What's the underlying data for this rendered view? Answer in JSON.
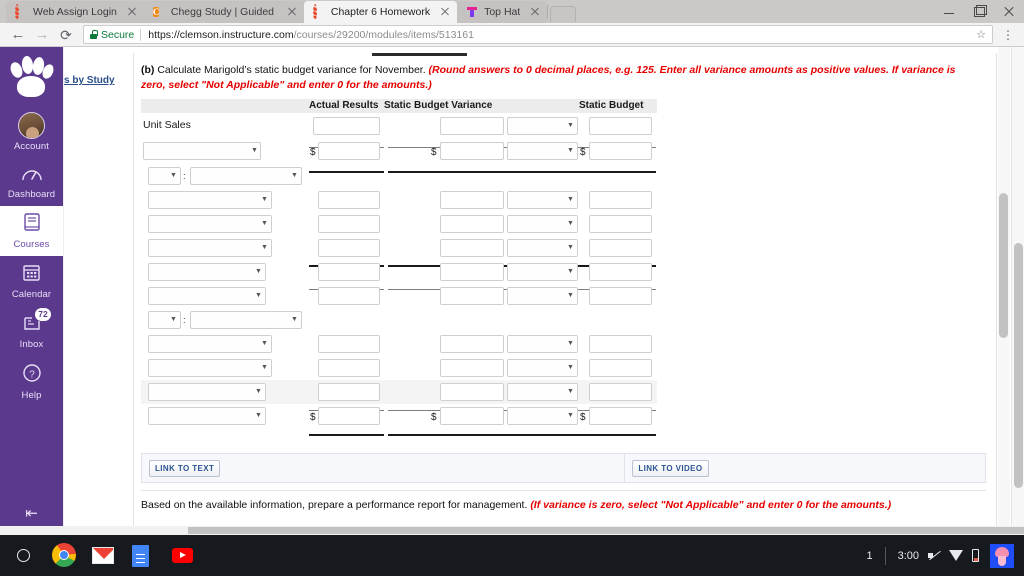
{
  "browser": {
    "tabs": [
      {
        "title": "Web Assign Login",
        "favicon": "spinner-icon",
        "active": false
      },
      {
        "title": "Chegg Study | Guided So",
        "favicon": "chegg-c-icon",
        "active": false
      },
      {
        "title": "Chapter 6 Homework",
        "favicon": "spinner-icon",
        "active": true
      },
      {
        "title": "Top Hat",
        "favicon": "tophat-t-icon",
        "active": false
      }
    ],
    "window_controls": {
      "minimize": "minimize-icon",
      "maximize": "restore-icon",
      "close": "close-icon"
    },
    "toolbar": {
      "back": "back-arrow-icon",
      "forward": "forward-arrow-icon",
      "reload": "reload-icon",
      "security_label": "Secure",
      "url_host": "https://clemson.instructure.com",
      "url_path": "/courses/29200/modules/items/513161",
      "bookmark": "star-icon",
      "menu": "kebab-menu-icon"
    }
  },
  "canvas_nav": {
    "logo": "clemson-paw-logo",
    "items": [
      {
        "label": "Account",
        "icon": "user-avatar-icon",
        "active": false,
        "badge": ""
      },
      {
        "label": "Dashboard",
        "icon": "dashboard-gauge-icon",
        "active": false,
        "badge": ""
      },
      {
        "label": "Courses",
        "icon": "book-icon",
        "active": true,
        "badge": ""
      },
      {
        "label": "Calendar",
        "icon": "calendar-icon",
        "active": false,
        "badge": ""
      },
      {
        "label": "Inbox",
        "icon": "inbox-icon",
        "active": false,
        "badge": "72"
      },
      {
        "label": "Help",
        "icon": "question-circle-icon",
        "active": false,
        "badge": ""
      }
    ],
    "collapse_label": "⇤"
  },
  "page": {
    "breadcrumb_link": "s by Study"
  },
  "assignment": {
    "prompt_prefix": "(b)",
    "prompt_text": " Calculate Marigold’s static budget variance for November. ",
    "prompt_note": "(Round answers to 0 decimal places, e.g. 125. Enter all variance amounts as positive values. If variance is zero, select \"Not Applicable\" and enter 0 for the amounts.)",
    "columns": {
      "blank": "",
      "actual_results": "Actual Results",
      "static_budget_variance": "Static Budget Variance",
      "static_budget": "Static Budget"
    },
    "rows": [
      {
        "label": "Unit Sales",
        "type": "label",
        "dollar": false,
        "shaded": false
      },
      {
        "label": "",
        "type": "select-wide",
        "dollar": true,
        "shaded": false
      },
      {
        "label": "",
        "type": "select-pair",
        "dollar": false,
        "shaded": false
      },
      {
        "label": "",
        "type": "select-mid",
        "dollar": false,
        "shaded": false
      },
      {
        "label": "",
        "type": "select-mid",
        "dollar": false,
        "shaded": false
      },
      {
        "label": "",
        "type": "select-mid",
        "dollar": false,
        "shaded": false
      },
      {
        "label": "",
        "type": "select-wide",
        "dollar": false,
        "shaded": false
      },
      {
        "label": "",
        "type": "select-wide",
        "dollar": false,
        "shaded": false
      },
      {
        "label": "",
        "type": "select-pair",
        "dollar": false,
        "shaded": false
      },
      {
        "label": "",
        "type": "select-mid",
        "dollar": false,
        "shaded": false
      },
      {
        "label": "",
        "type": "select-mid",
        "dollar": false,
        "shaded": false
      },
      {
        "label": "",
        "type": "select-wide",
        "dollar": false,
        "shaded": true
      },
      {
        "label": "",
        "type": "select-wide",
        "dollar": true,
        "shaded": false
      }
    ],
    "input_value": "",
    "select_value": "",
    "dollar_sign": "$",
    "link_to_text": "LINK TO TEXT",
    "link_to_video": "LINK TO VIDEO",
    "footer_text": "Based on the available information, prepare a performance report for management. ",
    "footer_note": "(If variance is zero, select \"Not Applicable\" and enter 0 for the amounts.)"
  },
  "taskbar": {
    "launcher": "launcher-circle-icon",
    "apps": [
      {
        "name": "chrome-icon"
      },
      {
        "name": "gmail-icon"
      },
      {
        "name": "google-docs-icon"
      },
      {
        "name": "youtube-icon"
      }
    ],
    "window_count": "1",
    "clock": "3:00",
    "mute": "volume-muted-icon",
    "wifi": "wifi-icon",
    "battery": "battery-low-icon",
    "avatar": "user-avatar-icon"
  },
  "colors": {
    "canvas_purple": "#5b3a8e",
    "red_note": "#e60000",
    "link_blue": "#2c5491",
    "secure_green": "#0b7a3b"
  }
}
